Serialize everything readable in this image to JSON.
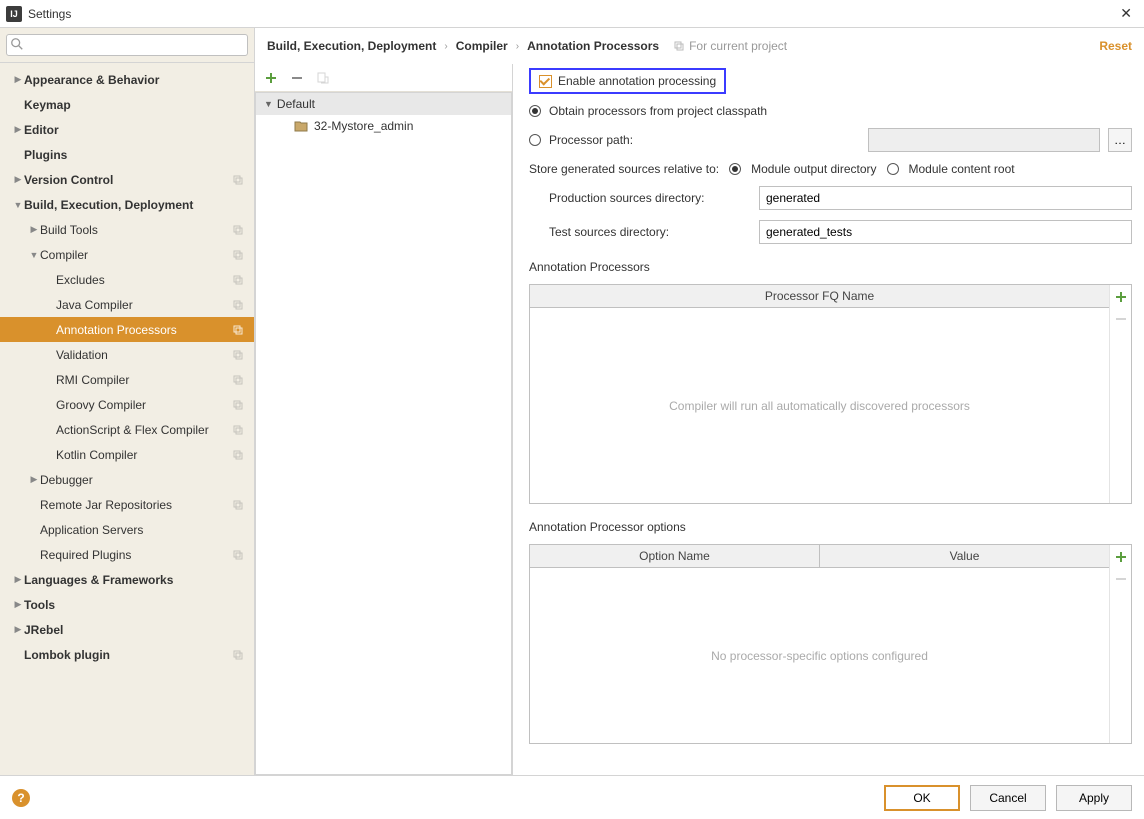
{
  "titlebar": {
    "icon": "IJ",
    "title": "Settings"
  },
  "search": {
    "placeholder": ""
  },
  "nav": {
    "appearance": "Appearance & Behavior",
    "keymap": "Keymap",
    "editor": "Editor",
    "plugins": "Plugins",
    "vcs": "Version Control",
    "bed": "Build, Execution, Deployment",
    "build_tools": "Build Tools",
    "compiler": "Compiler",
    "excludes": "Excludes",
    "java_compiler": "Java Compiler",
    "annotation_processors": "Annotation Processors",
    "validation": "Validation",
    "rmi": "RMI Compiler",
    "groovy": "Groovy Compiler",
    "asflex": "ActionScript & Flex Compiler",
    "kotlin": "Kotlin Compiler",
    "debugger": "Debugger",
    "remote_jar": "Remote Jar Repositories",
    "app_servers": "Application Servers",
    "req_plugins": "Required Plugins",
    "lang": "Languages & Frameworks",
    "tools": "Tools",
    "jrebel": "JRebel",
    "lombok": "Lombok plugin"
  },
  "crumbs": {
    "a": "Build, Execution, Deployment",
    "b": "Compiler",
    "c": "Annotation Processors",
    "forproject": "For current project",
    "reset": "Reset"
  },
  "profiles": {
    "default": "Default",
    "project": "32-Mystore_admin"
  },
  "form": {
    "enable": "Enable annotation processing",
    "obtain": "Obtain processors from project classpath",
    "procpath": "Processor path:",
    "procpath_value": "",
    "store_label": "Store generated sources relative to:",
    "module_out": "Module output directory",
    "module_root": "Module content root",
    "prod_label": "Production sources directory:",
    "prod_value": "generated",
    "test_label": "Test sources directory:",
    "test_value": "generated_tests",
    "ap_header": "Annotation Processors",
    "fq_header": "Processor FQ Name",
    "fq_empty": "Compiler will run all automatically discovered processors",
    "opt_header": "Annotation Processor options",
    "opt_name": "Option Name",
    "opt_value": "Value",
    "opt_empty": "No processor-specific options configured"
  },
  "buttons": {
    "ok": "OK",
    "cancel": "Cancel",
    "apply": "Apply"
  }
}
